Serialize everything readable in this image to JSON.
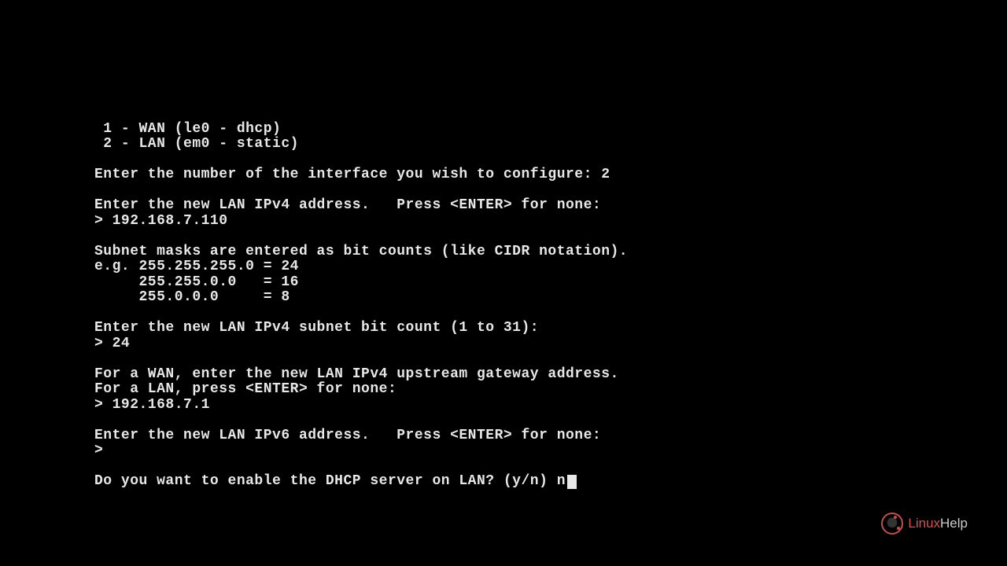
{
  "terminal": {
    "line1": " 1 - WAN (le0 - dhcp)",
    "line2": " 2 - LAN (em0 - static)",
    "line3": "",
    "line4": "Enter the number of the interface you wish to configure: 2",
    "line5": "",
    "line6": "Enter the new LAN IPv4 address.   Press <ENTER> for none:",
    "line7": "> 192.168.7.110",
    "line8": "",
    "line9": "Subnet masks are entered as bit counts (like CIDR notation).",
    "line10": "e.g. 255.255.255.0 = 24",
    "line11": "     255.255.0.0   = 16",
    "line12": "     255.0.0.0     = 8",
    "line13": "",
    "line14": "Enter the new LAN IPv4 subnet bit count (1 to 31):",
    "line15": "> 24",
    "line16": "",
    "line17": "For a WAN, enter the new LAN IPv4 upstream gateway address.",
    "line18": "For a LAN, press <ENTER> for none:",
    "line19": "> 192.168.7.1",
    "line20": "",
    "line21": "Enter the new LAN IPv6 address.   Press <ENTER> for none:",
    "line22": ">",
    "line23": "",
    "line24": "Do you want to enable the DHCP server on LAN? (y/n) n"
  },
  "logo": {
    "linux": "Linux",
    "help": "Help"
  }
}
